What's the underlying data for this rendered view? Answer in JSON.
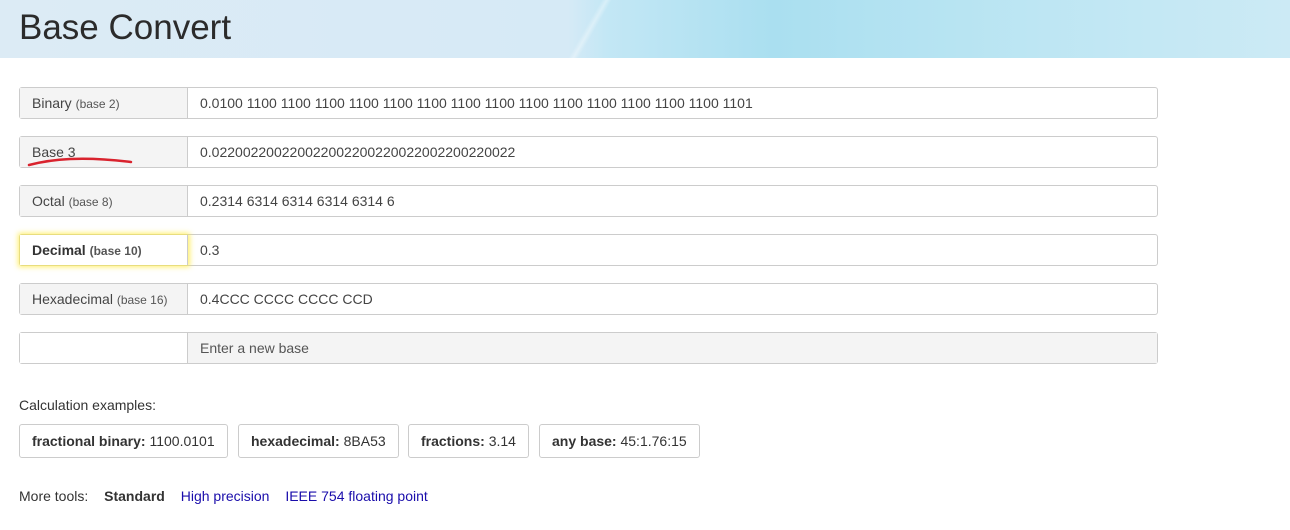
{
  "header": {
    "title": "Base Convert"
  },
  "rows": [
    {
      "label": "Binary",
      "sub": "(base 2)",
      "value": "0.0100 1100 1100 1100 1100 1100 1100 1100 1100 1100 1100 1100 1100 1100 1100 1101"
    },
    {
      "label": "Base 3",
      "sub": "",
      "value": "0.022002200220022002200220022002200220022"
    },
    {
      "label": "Octal",
      "sub": "(base 8)",
      "value": "0.2314 6314 6314 6314 6314 6"
    },
    {
      "label": "Decimal",
      "sub": "(base 10)",
      "value": "0.3"
    },
    {
      "label": "Hexadecimal",
      "sub": "(base 16)",
      "value": "0.4CCC CCCC CCCC CCD"
    }
  ],
  "new_base": {
    "label": "",
    "placeholder": "Enter a new base"
  },
  "examples": {
    "title": "Calculation examples:",
    "items": [
      {
        "key": "fractional binary:",
        "value": "1100.0101"
      },
      {
        "key": "hexadecimal:",
        "value": "8BA53"
      },
      {
        "key": "fractions:",
        "value": "3.14"
      },
      {
        "key": "any base:",
        "value": "45:1.76:15"
      }
    ]
  },
  "tools": {
    "label": "More tools:",
    "current": "Standard",
    "links": [
      "High precision",
      "IEEE 754 floating point"
    ]
  },
  "colors": {
    "annotation_mark": "#d9232e",
    "focus_glow": "#ffeb3c",
    "link": "#1a0dab"
  }
}
